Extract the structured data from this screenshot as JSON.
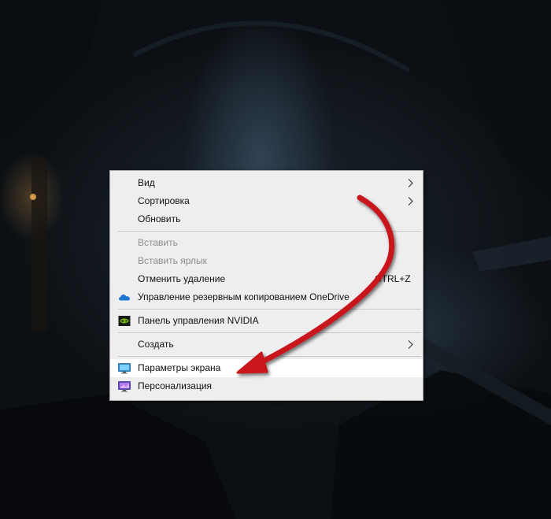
{
  "context_menu": {
    "items": [
      {
        "label": "Вид",
        "icon": "",
        "has_submenu": true
      },
      {
        "label": "Сортировка",
        "icon": "",
        "has_submenu": true
      },
      {
        "label": "Обновить",
        "icon": "",
        "has_submenu": false
      },
      {
        "label": "Вставить",
        "icon": "",
        "disabled": true
      },
      {
        "label": "Вставить ярлык",
        "icon": "",
        "disabled": true
      },
      {
        "label": "Отменить удаление",
        "shortcut": "CTRL+Z"
      },
      {
        "label": "Управление резервным копированием OneDrive",
        "icon": "onedrive-cloud-icon"
      },
      {
        "label": "Панель управления NVIDIA",
        "icon": "nvidia-icon"
      },
      {
        "label": "Создать",
        "icon": "",
        "has_submenu": true
      },
      {
        "label": "Параметры экрана",
        "icon": "display-settings-icon",
        "highlighted": true
      },
      {
        "label": "Персонализация",
        "icon": "personalization-icon"
      }
    ]
  },
  "annotation": {
    "arrow_color": "#c8141b",
    "points_to": "Параметры экрана"
  },
  "colors": {
    "menu_background": "#eeeeee",
    "highlight_background": "#ffffff",
    "disabled_text": "#8c8c8c",
    "onedrive_blue": "#1f78d6",
    "nvidia_green": "#76b900"
  }
}
